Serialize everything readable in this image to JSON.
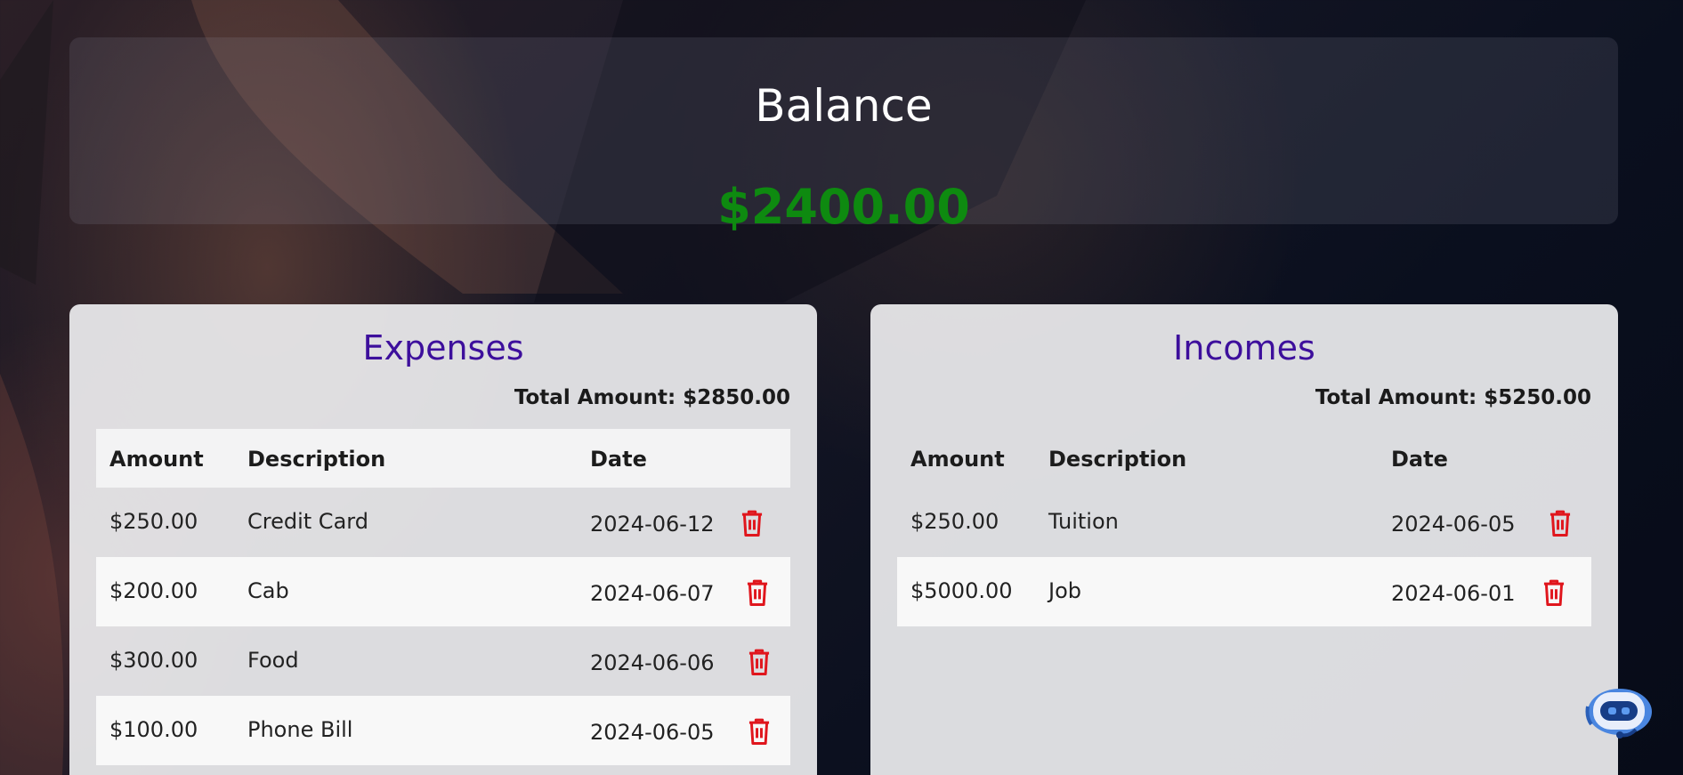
{
  "balance": {
    "title": "Balance",
    "amount": "$2400.00",
    "amount_color": "#0e8a10"
  },
  "expenses": {
    "title": "Expenses",
    "total": "Total Amount: $2850.00",
    "columns": [
      "Amount",
      "Description",
      "Date"
    ],
    "rows": [
      {
        "amount": "$250.00",
        "description": "Credit Card",
        "date": "2024-06-12"
      },
      {
        "amount": "$200.00",
        "description": "Cab",
        "date": "2024-06-07"
      },
      {
        "amount": "$300.00",
        "description": "Food",
        "date": "2024-06-06"
      },
      {
        "amount": "$100.00",
        "description": "Phone Bill",
        "date": "2024-06-05"
      }
    ]
  },
  "incomes": {
    "title": "Incomes",
    "total": "Total Amount: $5250.00",
    "columns": [
      "Amount",
      "Description",
      "Date"
    ],
    "rows": [
      {
        "amount": "$250.00",
        "description": "Tuition",
        "date": "2024-06-05"
      },
      {
        "amount": "$5000.00",
        "description": "Job",
        "date": "2024-06-01"
      }
    ]
  },
  "icons": {
    "delete": "trash-icon",
    "assistant": "chatbot-icon"
  },
  "colors": {
    "title_accent": "#3d0f9c",
    "delete_icon": "#e0161d"
  }
}
